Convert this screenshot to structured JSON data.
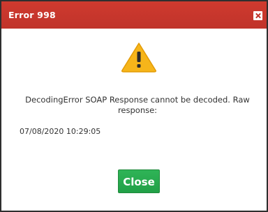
{
  "dialog": {
    "title": "Error 998",
    "close_icon": "close-icon",
    "warning_icon": "warning-triangle-icon",
    "message": "DecodingError SOAP Response cannot be decoded. Raw response:",
    "timestamp": "07/08/2020 10:29:05",
    "close_button_label": "Close"
  },
  "colors": {
    "titlebar": "#c0332a",
    "close_button": "#21a047",
    "warning_fill": "#f6b51a"
  }
}
